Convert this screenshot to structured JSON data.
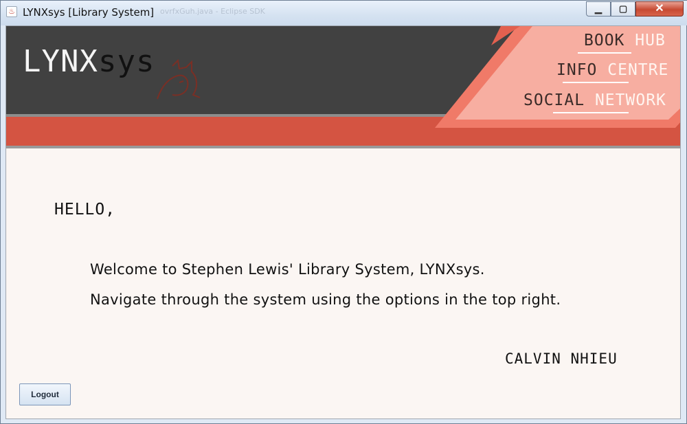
{
  "window": {
    "title": "LYNXsys [Library System]",
    "ghost_title": "ovrfxGuh.java - Eclipse SDK",
    "app_icon": "java-icon",
    "controls": {
      "minimize": "minimize-icon",
      "maximize": "maximize-icon",
      "close": "close-icon"
    }
  },
  "header": {
    "logo_part1": "LYNX",
    "logo_part2": "sys",
    "logo_mascot": "lynx-cat-icon",
    "nav": [
      {
        "word1": "BOOK",
        "word2": "HUB"
      },
      {
        "word1": "INFO",
        "word2": "CENTRE"
      },
      {
        "word1": "SOCIAL",
        "word2": "NETWORK"
      }
    ]
  },
  "main": {
    "greeting": "HELLO,",
    "line1": "Welcome to Stephen Lewis' Library System, LYNXsys.",
    "line2": "Navigate through the system using the options in the top right.",
    "signature": "CALVIN NHIEU",
    "logout_label": "Logout"
  },
  "colors": {
    "header_dark": "#414141",
    "band_red": "#d45442",
    "panel_salmon": "#f39b8e",
    "panel_light": "#f7aea1",
    "content_bg": "#fbf6f3"
  }
}
